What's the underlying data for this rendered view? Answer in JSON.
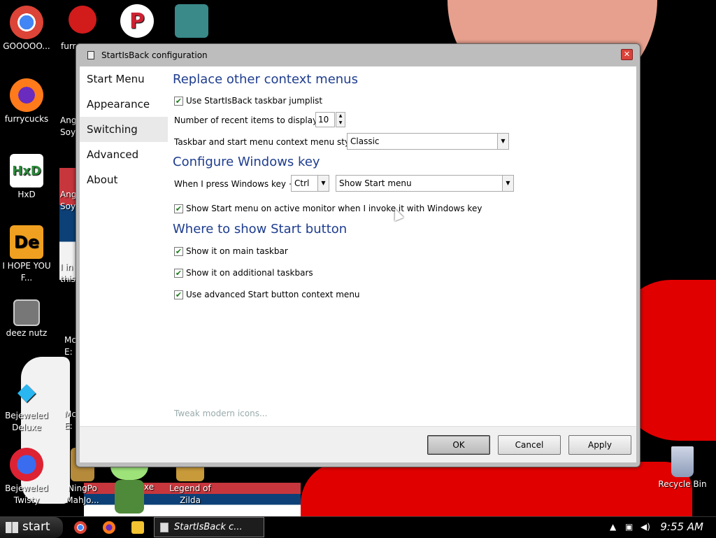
{
  "desktop": {
    "icons": [
      {
        "label": "GOOOOO...",
        "icon": "chrome-icon"
      },
      {
        "label": "furrycucks",
        "icon": "firefox-icon"
      },
      {
        "label": "HxD",
        "icon": "hxd-icon"
      },
      {
        "label": "I HOPE YOU F...",
        "icon": "de-icon"
      },
      {
        "label": "deez nutz",
        "icon": "folder-copy-icon"
      },
      {
        "label": "Bejeweled Deluxe",
        "icon": "diamond-icon"
      },
      {
        "label": "Bejeweled Twisty",
        "icon": "gem-icon"
      },
      {
        "label": "NingPo MahJo...",
        "icon": "mahjong-icon"
      },
      {
        "label": "Legend of Zilda",
        "icon": "zelda-icon"
      },
      {
        "label": "Recycle Bin",
        "icon": "recycle-bin-icon"
      }
    ],
    "partial_labels": [
      "furr",
      "Angr Soy",
      "Angr Soy",
      "I in this",
      "Mc E:",
      "Mc E:",
      "xe"
    ]
  },
  "dialog": {
    "title": "StartIsBack configuration",
    "close": "✕",
    "sidebar": [
      "Start Menu",
      "Appearance",
      "Switching",
      "Advanced",
      "About"
    ],
    "section1": {
      "heading": "Replace other context menus",
      "jumplist": "Use StartIsBack taskbar jumplist",
      "recent_label": "Number of recent items to display:",
      "recent_value": "10",
      "style_label": "Taskbar and start menu context menu style",
      "style_value": "Classic"
    },
    "section2": {
      "heading": "Configure Windows key",
      "key_label": "When I press Windows key +",
      "key_value": "Ctrl",
      "action_value": "Show Start menu",
      "monitor": "Show Start menu on active monitor when I invoke it with Windows key"
    },
    "section3": {
      "heading": "Where to show Start button",
      "main": "Show it on main taskbar",
      "additional": "Show it on additional taskbars",
      "advanced": "Use advanced Start button context menu"
    },
    "tweak": "Tweak modern icons...",
    "buttons": {
      "ok": "OK",
      "cancel": "Cancel",
      "apply": "Apply"
    }
  },
  "taskbar": {
    "start": "start",
    "task": "StartIsBack c...",
    "clock": "9:55 AM"
  }
}
